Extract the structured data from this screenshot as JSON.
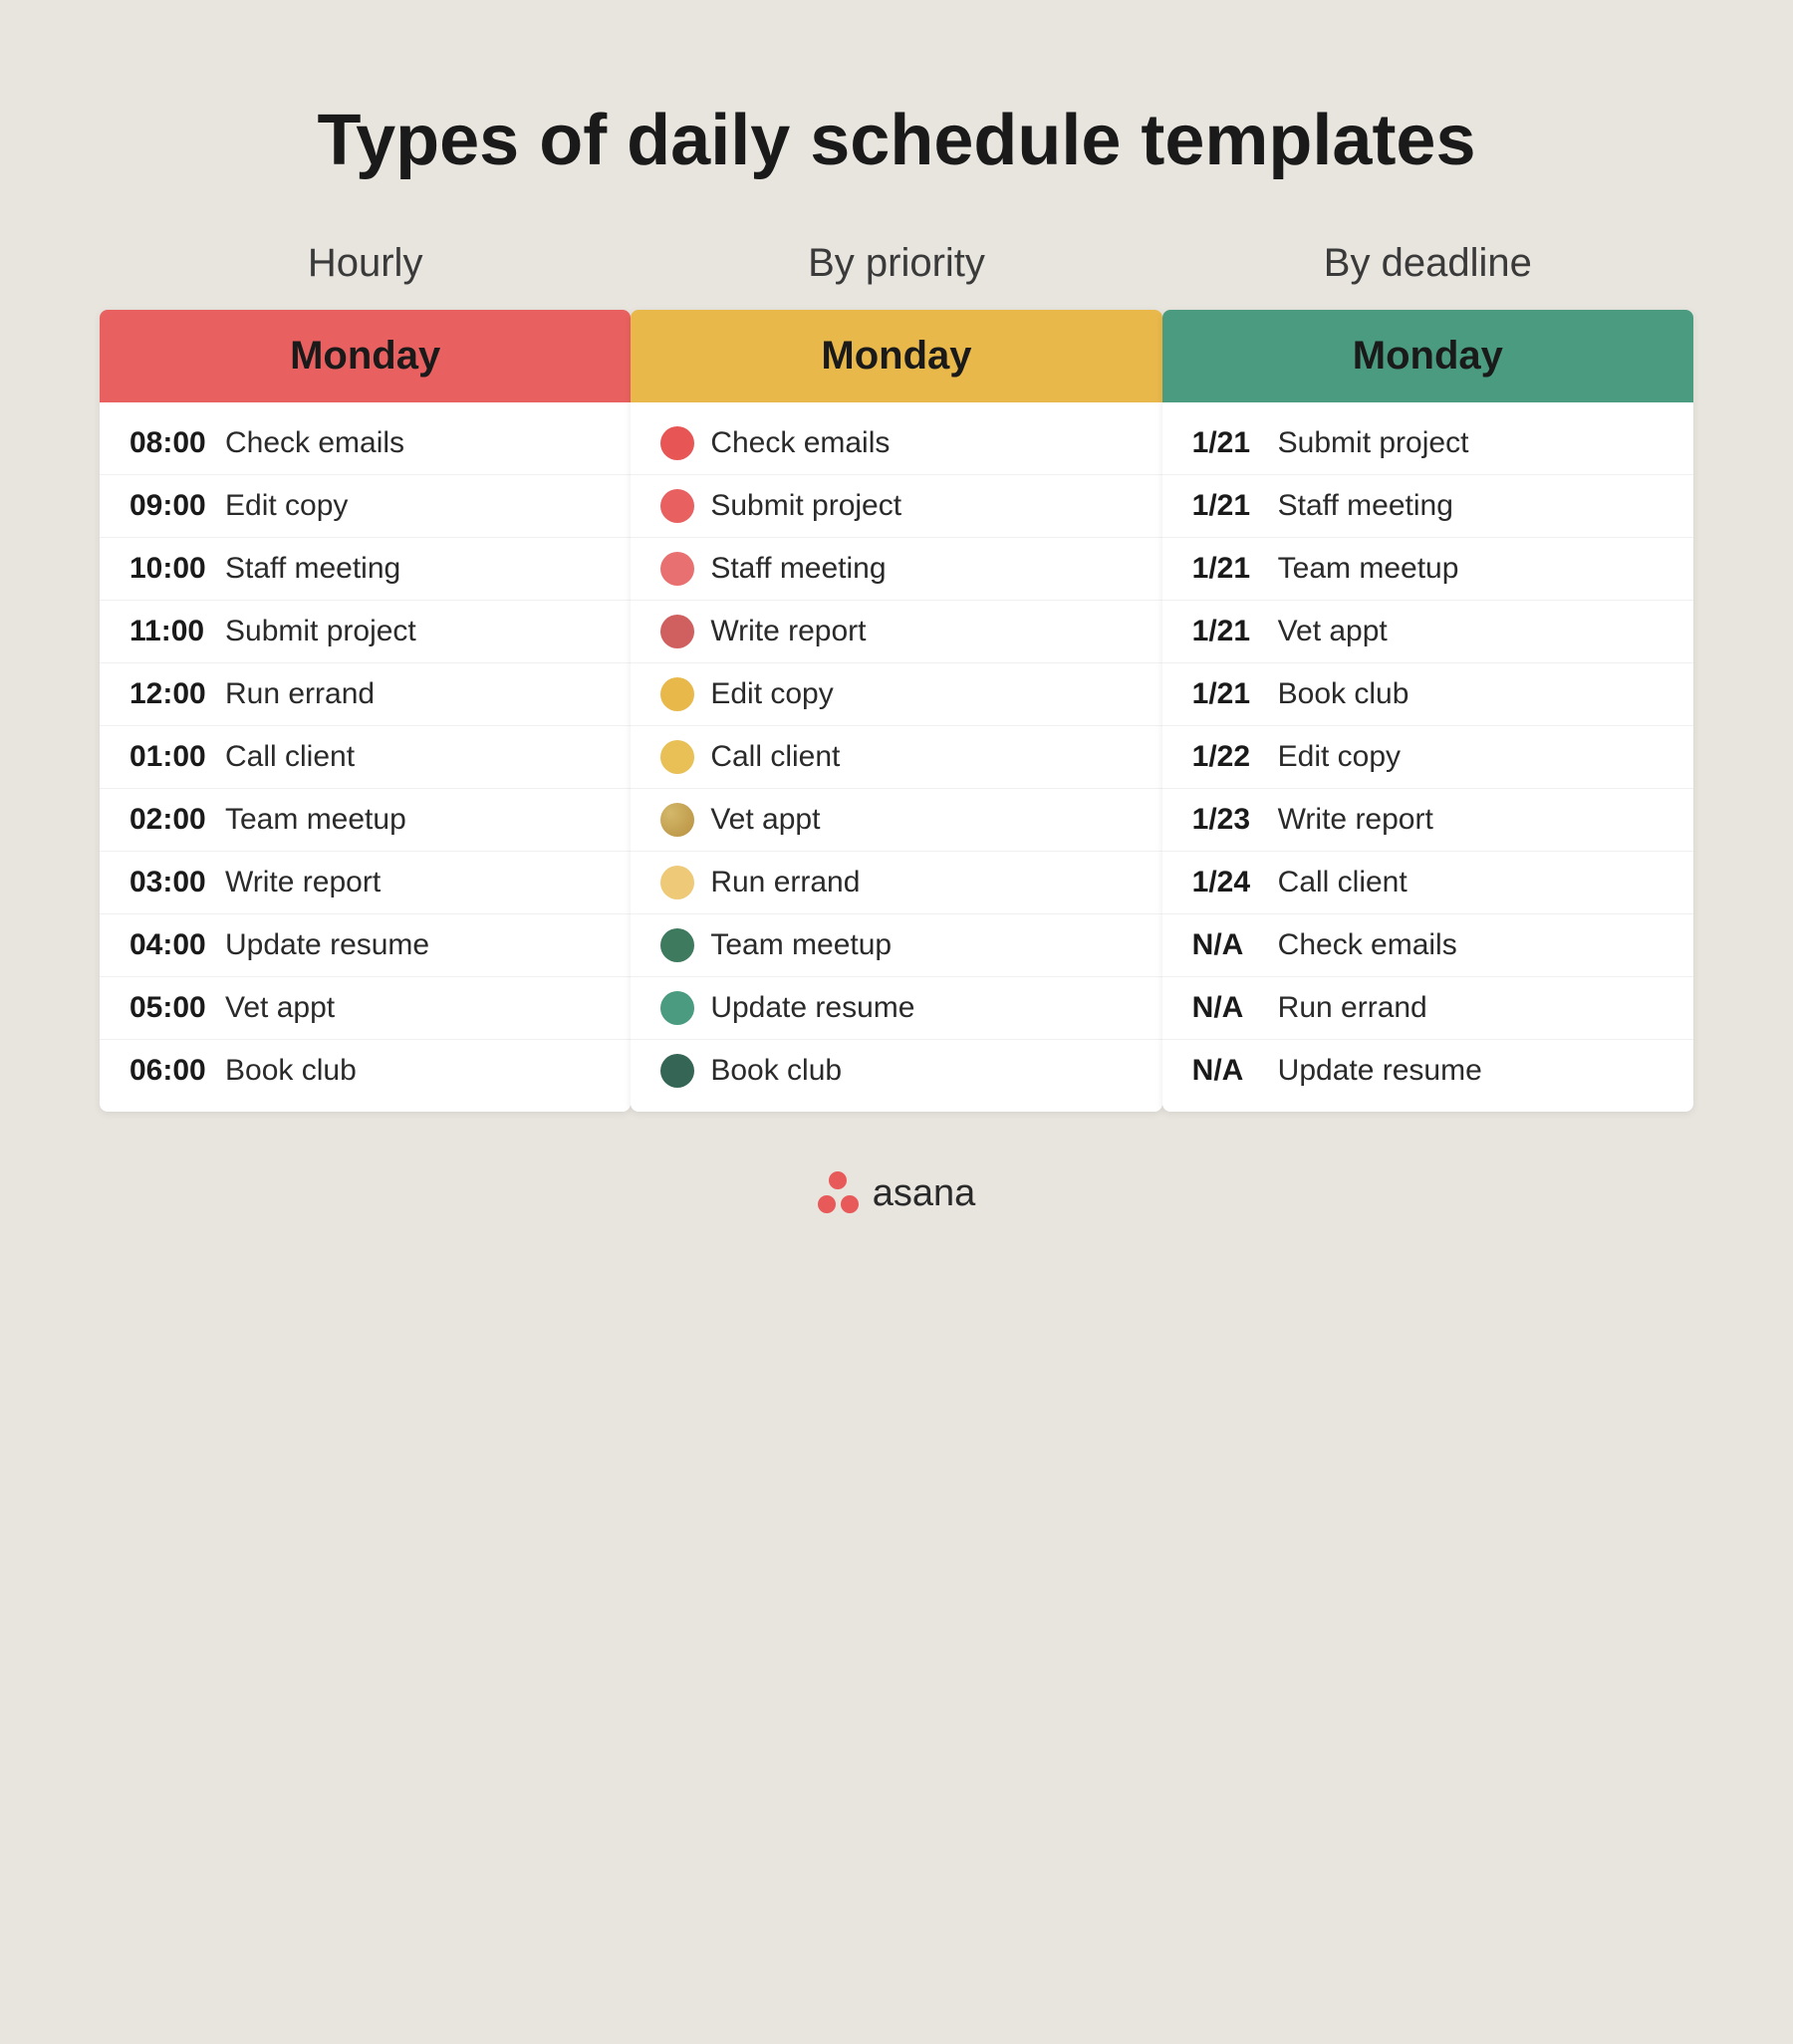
{
  "page": {
    "title": "Types of daily schedule templates",
    "background_color": "#e8e4de"
  },
  "columns": [
    {
      "id": "hourly",
      "header_label": "Hourly",
      "card_header": "Monday",
      "card_header_color": "red",
      "rows": [
        {
          "time": "08:00",
          "task": "Check emails"
        },
        {
          "time": "09:00",
          "task": "Edit copy"
        },
        {
          "time": "10:00",
          "task": "Staff meeting"
        },
        {
          "time": "11:00",
          "task": "Submit project"
        },
        {
          "time": "12:00",
          "task": "Run errand"
        },
        {
          "time": "01:00",
          "task": "Call client"
        },
        {
          "time": "02:00",
          "task": "Team meetup"
        },
        {
          "time": "03:00",
          "task": "Write report"
        },
        {
          "time": "04:00",
          "task": "Update resume"
        },
        {
          "time": "05:00",
          "task": "Vet appt"
        },
        {
          "time": "06:00",
          "task": "Book club"
        }
      ]
    },
    {
      "id": "priority",
      "header_label": "By priority",
      "card_header": "Monday",
      "card_header_color": "yellow",
      "rows": [
        {
          "dot_class": "dot-red-1",
          "task": "Check emails"
        },
        {
          "dot_class": "dot-red-2",
          "task": "Submit project"
        },
        {
          "dot_class": "dot-red-3",
          "task": "Staff meeting"
        },
        {
          "dot_class": "dot-red-4",
          "task": "Write report"
        },
        {
          "dot_class": "dot-yellow-1",
          "task": "Edit copy"
        },
        {
          "dot_class": "dot-yellow-2",
          "task": "Call client"
        },
        {
          "dot_class": "dot-tan",
          "task": "Vet appt"
        },
        {
          "dot_class": "dot-yellow-1",
          "task": "Run errand"
        },
        {
          "dot_class": "dot-green-dark",
          "task": "Team meetup"
        },
        {
          "dot_class": "dot-green-med",
          "task": "Update resume"
        },
        {
          "dot_class": "dot-green-dark2",
          "task": "Book club"
        }
      ]
    },
    {
      "id": "deadline",
      "header_label": "By deadline",
      "card_header": "Monday",
      "card_header_color": "green",
      "rows": [
        {
          "date": "1/21",
          "task": "Submit project"
        },
        {
          "date": "1/21",
          "task": "Staff meeting"
        },
        {
          "date": "1/21",
          "task": "Team meetup"
        },
        {
          "date": "1/21",
          "task": "Vet appt"
        },
        {
          "date": "1/21",
          "task": "Book club"
        },
        {
          "date": "1/22",
          "task": "Edit copy"
        },
        {
          "date": "1/23",
          "task": "Write report"
        },
        {
          "date": "1/24",
          "task": "Call client"
        },
        {
          "date": "N/A",
          "task": "Check emails"
        },
        {
          "date": "N/A",
          "task": "Run errand"
        },
        {
          "date": "N/A",
          "task": "Update resume"
        }
      ]
    }
  ],
  "footer": {
    "brand_name": "asana"
  }
}
